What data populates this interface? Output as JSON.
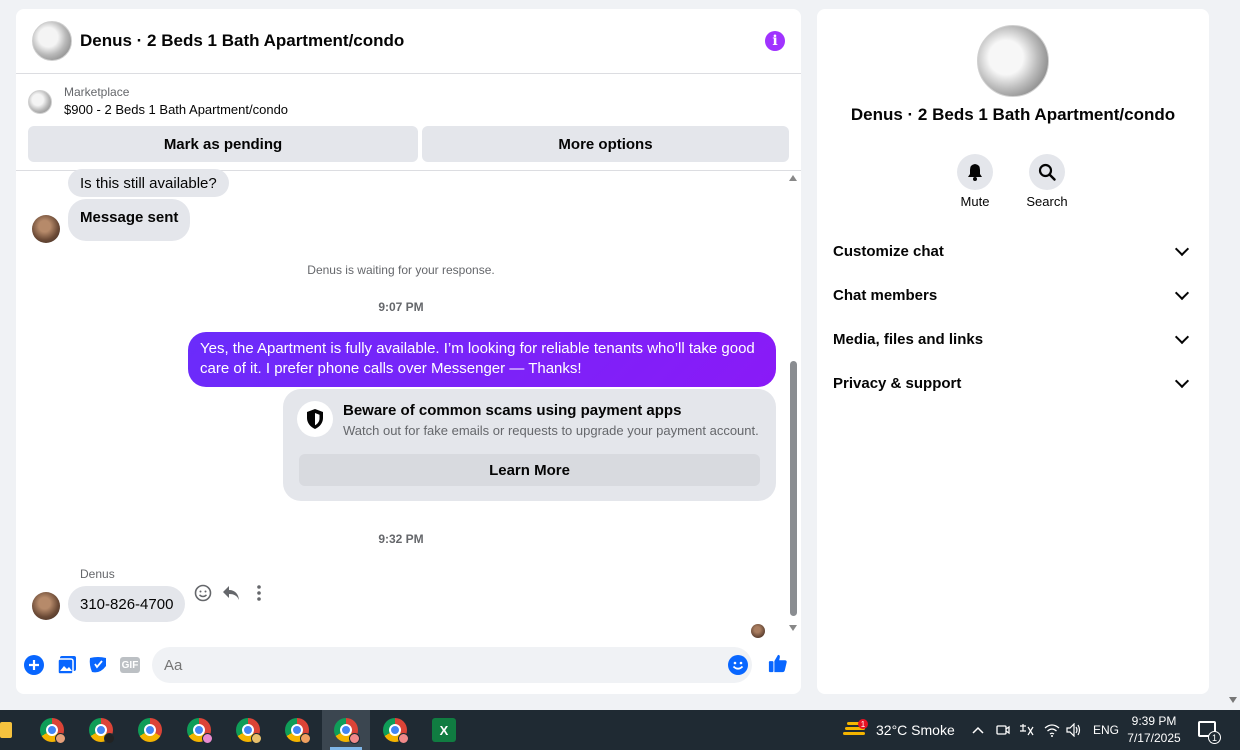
{
  "chat": {
    "title": "Denus · 2 Beds 1 Bath Apartment/condo",
    "marketplace": {
      "label": "Marketplace",
      "item": "$900 - 2 Beds 1 Bath Apartment/condo",
      "mark_pending": "Mark as pending",
      "more_options": "More options"
    },
    "messages": {
      "incoming_1": "Is this still available?",
      "incoming_2": "Message sent",
      "waiting_note": "Denus is waiting for your response.",
      "time_1": "9:07 PM",
      "outgoing": "Yes, the Apartment is fully available. I’m looking for reliable tenants who’ll take good care of it. I prefer phone calls over Messenger —  Thanks!",
      "scam_title": "Beware of common scams using payment apps",
      "scam_desc": "Watch out for fake emails or requests to upgrade your payment account.",
      "learn_more": "Learn More",
      "time_2": "9:32 PM",
      "sender": "Denus",
      "incoming_3": "310-826-4700"
    },
    "composer": {
      "placeholder": "Aa",
      "gif_label": "GIF"
    }
  },
  "info_panel": {
    "title": "Denus · 2 Beds 1 Bath Apartment/condo",
    "actions": [
      "Mute",
      "Search"
    ],
    "sections": [
      "Customize chat",
      "Chat members",
      "Media, files and links",
      "Privacy & support"
    ]
  },
  "taskbar": {
    "weather_badge": "1",
    "weather": "32°C  Smoke",
    "language": "ENG",
    "time": "9:39 PM",
    "date": "7/17/2025",
    "notifications": "1",
    "excel_letter": "X"
  },
  "colors": {
    "accent": "#7a1cfa",
    "info": "#a033ff",
    "messenger_blue": "#0866ff"
  },
  "icons": [
    "info-icon",
    "shield-icon",
    "emoji-icon",
    "reply-icon",
    "more-icon",
    "plus-icon",
    "image-icon",
    "sticker-icon",
    "gif-icon",
    "smile-icon",
    "thumbs-up-icon",
    "bell-icon",
    "search-icon",
    "chevron-down-icon"
  ]
}
